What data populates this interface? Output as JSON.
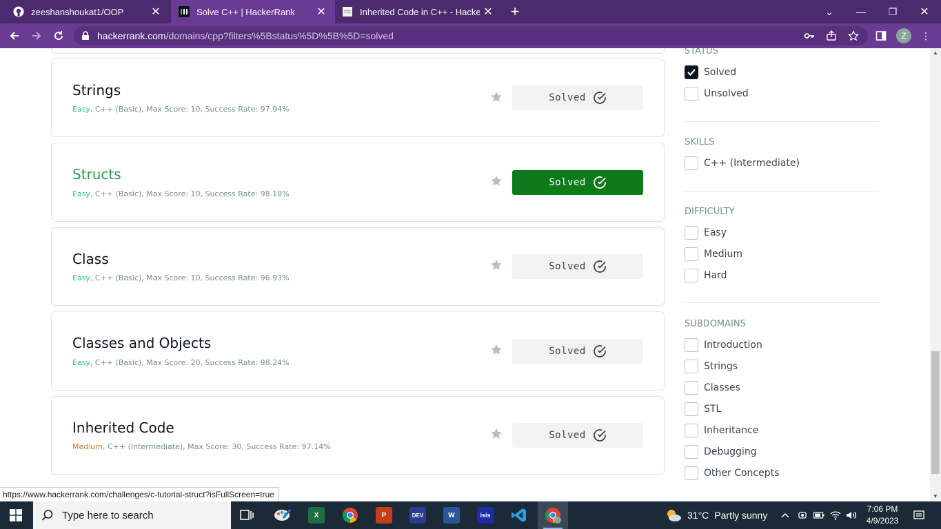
{
  "browser": {
    "tabs": [
      {
        "title": "zeeshanshoukat1/OOP",
        "icon": "github-icon",
        "active": false
      },
      {
        "title": "Solve C++ | HackerRank",
        "icon": "hackerrank-icon",
        "active": true
      },
      {
        "title": "Inherited Code in C++ - Hacker Rank",
        "icon": "page-icon",
        "active": false
      }
    ],
    "url_host": "hackerrank.com",
    "url_path": "/domains/cpp?filters%5Bstatus%5D%5B%5D=solved",
    "profile_initial": "Z"
  },
  "challenges": [
    {
      "name": "Strings",
      "difficulty": "Easy",
      "rest": ", C++ (Basic), Max Score: 10, Success Rate: 97.94%",
      "status": "Solved",
      "hovered": false
    },
    {
      "name": "Structs",
      "difficulty": "Easy",
      "rest": ", C++ (Basic), Max Score: 10, Success Rate: 98.18%",
      "status": "Solved",
      "hovered": true
    },
    {
      "name": "Class",
      "difficulty": "Easy",
      "rest": ", C++ (Basic), Max Score: 10, Success Rate: 96.93%",
      "status": "Solved",
      "hovered": false
    },
    {
      "name": "Classes and Objects",
      "difficulty": "Easy",
      "rest": ", C++ (Basic), Max Score: 20, Success Rate: 98.24%",
      "status": "Solved",
      "hovered": false
    },
    {
      "name": "Inherited Code",
      "difficulty": "Medium",
      "rest": ", C++ (Intermediate), Max Score: 30, Success Rate: 97.14%",
      "status": "Solved",
      "hovered": false
    }
  ],
  "filters": {
    "status": {
      "title": "STATUS",
      "options": [
        {
          "label": "Solved",
          "checked": true
        },
        {
          "label": "Unsolved",
          "checked": false
        }
      ]
    },
    "skills": {
      "title": "SKILLS",
      "options": [
        {
          "label": "C++ (Intermediate)",
          "checked": false
        }
      ]
    },
    "difficulty": {
      "title": "DIFFICULTY",
      "options": [
        {
          "label": "Easy",
          "checked": false
        },
        {
          "label": "Medium",
          "checked": false
        },
        {
          "label": "Hard",
          "checked": false
        }
      ]
    },
    "subdomains": {
      "title": "SUBDOMAINS",
      "options": [
        {
          "label": "Introduction",
          "checked": false
        },
        {
          "label": "Strings",
          "checked": false
        },
        {
          "label": "Classes",
          "checked": false
        },
        {
          "label": "STL",
          "checked": false
        },
        {
          "label": "Inheritance",
          "checked": false
        },
        {
          "label": "Debugging",
          "checked": false
        },
        {
          "label": "Other Concepts",
          "checked": false
        }
      ]
    }
  },
  "status_url": "https://www.hackerrank.com/challenges/c-tutorial-struct?isFullScreen=true",
  "taskbar": {
    "search_placeholder": "Type here to search",
    "weather_temp": "31°C",
    "weather_text": "Partly sunny",
    "time": "7:06 PM",
    "date": "4/9/2023"
  },
  "colors": {
    "browser_frame": "#4c2a6e",
    "solved_green": "#0e7a19",
    "link_green": "#2a9d47",
    "easy": "#2ec866",
    "medium": "#c9742c"
  }
}
